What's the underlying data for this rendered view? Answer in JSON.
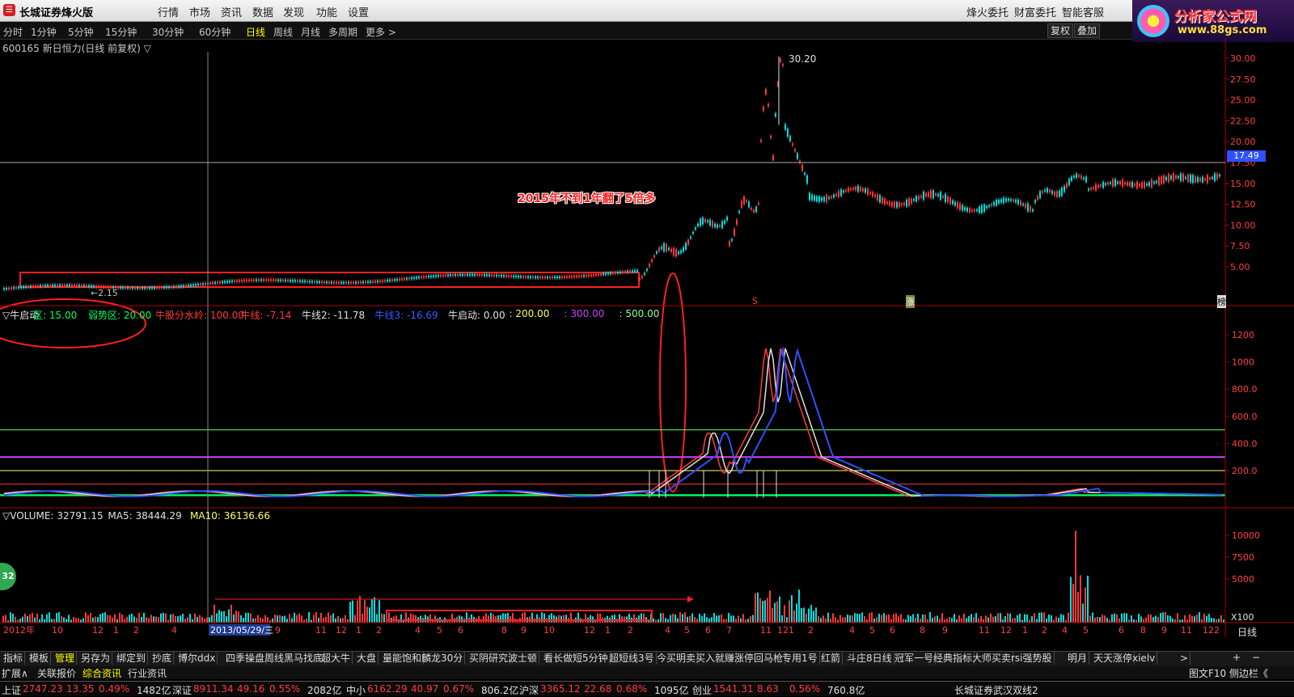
{
  "app": {
    "title": "长城证券烽火版",
    "logo_char": "☰",
    "menu": [
      "行情",
      "市场",
      "资讯",
      "数据",
      "发现",
      "功能",
      "设置"
    ],
    "menu_right": [
      "烽火委托",
      "财富委托",
      "智能客服"
    ],
    "brand_name": "分析家公式网",
    "brand_url": "www.88gs.com"
  },
  "periods": [
    "分时",
    "1分钟",
    "5分钟",
    "15分钟",
    "30分钟",
    "60分钟",
    "日线",
    "周线",
    "月线",
    "多周期",
    "更多 >"
  ],
  "active_period": "日线",
  "right_tools": [
    "复权",
    "叠加"
  ],
  "stock_title": "600165 新日恒力(日线 前复权) ▽",
  "price_panel": {
    "y_ticks": [
      "30.00",
      "27.50",
      "25.00",
      "22.50",
      "20.00",
      "17.50",
      "15.00",
      "12.50",
      "10.00",
      "7.50",
      "5.00"
    ],
    "current_price": "17.49",
    "high_label": "30.20",
    "low_label": "←2.15",
    "annotation": "2015年不到1年翻了5倍多",
    "marker_s": "S",
    "marker_zhang": "涨",
    "marker_end": "榜"
  },
  "indicator": {
    "legend": [
      {
        "text": "▽牛启动",
        "color": "#e0e0e0"
      },
      {
        "text": "区: 15.00",
        "color": "#00ff60"
      },
      {
        "text": "弱势区: 20.00",
        "color": "#00ff60"
      },
      {
        "text": "牛股分水岭: 100.00",
        "color": "#ff3b3b"
      },
      {
        "text": "牛线: -7.14",
        "color": "#ff3b3b"
      },
      {
        "text": "牛线2: -11.78",
        "color": "#e0e0e0"
      },
      {
        "text": "牛线3: -16.69",
        "color": "#3b5bff"
      },
      {
        "text": "牛启动: 0.00",
        "color": "#e0e0e0"
      },
      {
        "text": ": 200.00",
        "color": "#ffff60"
      },
      {
        "text": ": 300.00",
        "color": "#d040ff"
      },
      {
        "text": ": 500.00",
        "color": "#90ff90"
      }
    ],
    "y_ticks": [
      "1200",
      "1000",
      "800.0",
      "600.0",
      "400.0",
      "200.0"
    ]
  },
  "volume": {
    "legend": [
      {
        "text": "▽VOLUME: 32791.15",
        "color": "#e0e0e0"
      },
      {
        "text": "MA5: 38444.29",
        "color": "#e0e0e0"
      },
      {
        "text": "MA10: 36136.66",
        "color": "#ffff60"
      }
    ],
    "y_ticks": [
      "10000",
      "7500",
      "5000"
    ],
    "unit": "X100",
    "badge": "32"
  },
  "date_axis": {
    "labels": [
      "2012年",
      "10",
      "12",
      "1",
      "2",
      "4",
      "2013/05/29/三",
      "9",
      "11",
      "12",
      "1",
      "2",
      "4",
      "5",
      "6",
      "8",
      "9",
      "10",
      "12",
      "1",
      "2",
      "4",
      "5",
      "6",
      "7",
      "11",
      "12",
      "1",
      "2",
      "4",
      "5",
      "6",
      "8",
      "9",
      "11",
      "12",
      "1",
      "2",
      "4",
      "5",
      "6",
      "8",
      "9",
      "11",
      "12",
      "2"
    ],
    "period": "日线"
  },
  "tabs": [
    "指标",
    "模板",
    "管理",
    "另存为",
    "绑定到",
    "抄底",
    "博尔ddx",
    "四季操盘",
    "周线黑马找底",
    "超大牛",
    "大盘",
    "量能饱和",
    "麟龙30分",
    "买阴研究",
    "波士顿",
    "看长做短5分钟",
    "超短线3号",
    "今买明卖",
    "买入就赚",
    "涨停回马枪",
    "专用1号",
    "红箭",
    "斗庄8日线",
    "冠军一号",
    "经典指标",
    "大师买卖",
    "rsi强势股",
    "明月",
    "天天涨停",
    "xielv",
    ">"
  ],
  "active_tab": "管理",
  "subtabs": [
    "扩展∧",
    "关联报价",
    "综合资讯",
    "行业资讯"
  ],
  "active_subtab": "综合资讯",
  "subtab_right": [
    "图文F10",
    "侧边栏《"
  ],
  "status": [
    {
      "name": "上证",
      "value": "2747.23",
      "change": "13.35",
      "pct": "0.49%",
      "amount": "1482亿"
    },
    {
      "name": "深证",
      "value": "8911.34",
      "change": "49.16",
      "pct": "0.55%",
      "amount": "2082亿"
    },
    {
      "name": "中小",
      "value": "6162.29",
      "change": "40.97",
      "pct": "0.67%",
      "amount": "806.2亿"
    },
    {
      "name": "沪深",
      "value": "3365.12",
      "change": "22.68",
      "pct": "0.68%",
      "amount": "1095亿"
    },
    {
      "name": "创业",
      "value": "1541.31",
      "change": "8.63",
      "pct": "0.56%",
      "amount": "760.8亿"
    }
  ],
  "status_right": "长城证券武汉双线2",
  "colors": {
    "up": "#ff3b3b",
    "down": "#00ffff",
    "grid": "#aa0000"
  }
}
